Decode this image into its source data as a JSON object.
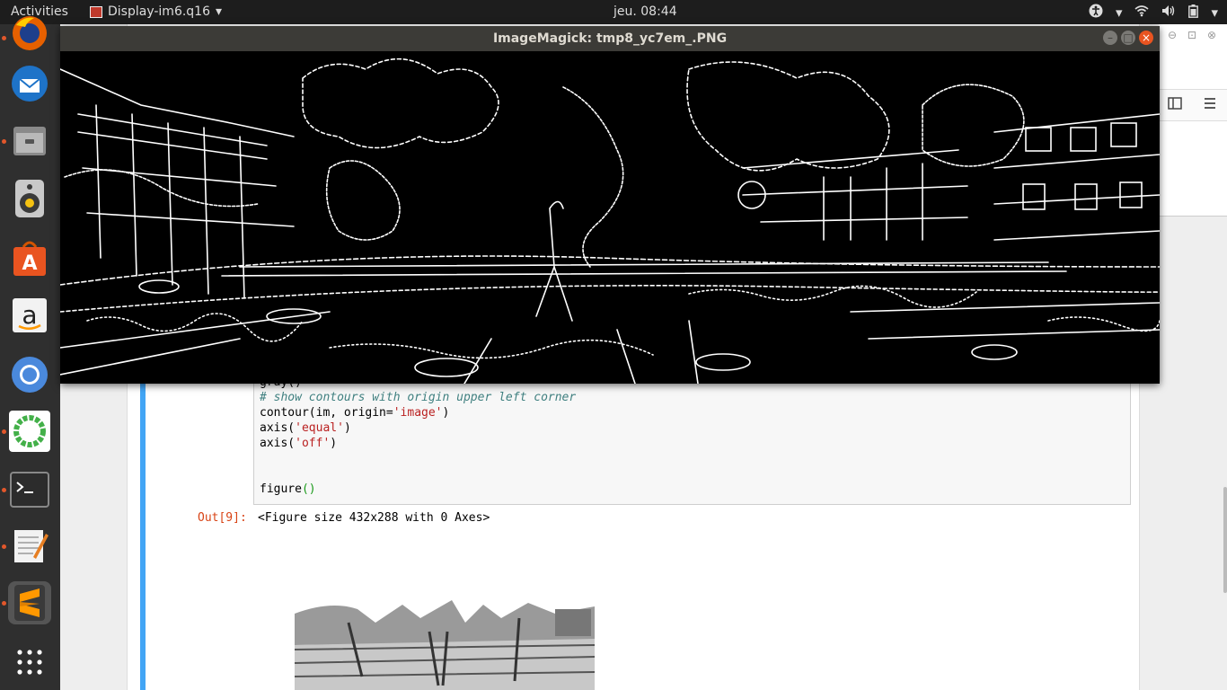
{
  "topbar": {
    "activities": "Activities",
    "app_name": "Display-im6.q16",
    "clock": "jeu. 08:44"
  },
  "im_window": {
    "title": "ImageMagick: tmp8_yc7em_.PNG"
  },
  "notebook": {
    "code_lines": {
      "l1": "gray()",
      "l2": "# show contours with origin upper left corner",
      "l3_prefix": "contour(im, origin=",
      "l3_string": "'image'",
      "l3_suffix": ")",
      "l4_prefix": "axis(",
      "l4_string": "'equal'",
      "l4_suffix": ")",
      "l5_prefix": "axis(",
      "l5_string": "'off'",
      "l5_suffix": ")",
      "l6_prefix": "figure",
      "l6_paren": "()"
    },
    "out_prompt": "Out[9]:",
    "out_text": "<Figure size 432x288 with 0 Axes>"
  },
  "colors": {
    "topbar_bg": "#1d1d1d",
    "dock_bg": "#2f2f2f",
    "titlebar_bg": "#3c3b37",
    "cell_accent": "#42a5f5",
    "out_prompt": "#d84315"
  },
  "dock_icons": [
    "firefox-icon",
    "thunderbird-icon",
    "files-icon",
    "rhythmbox-icon",
    "software-center-icon",
    "amazon-icon",
    "chromium-icon",
    "anaconda-icon",
    "terminal-icon",
    "text-editor-icon",
    "sublime-text-icon",
    "show-apps-icon"
  ]
}
